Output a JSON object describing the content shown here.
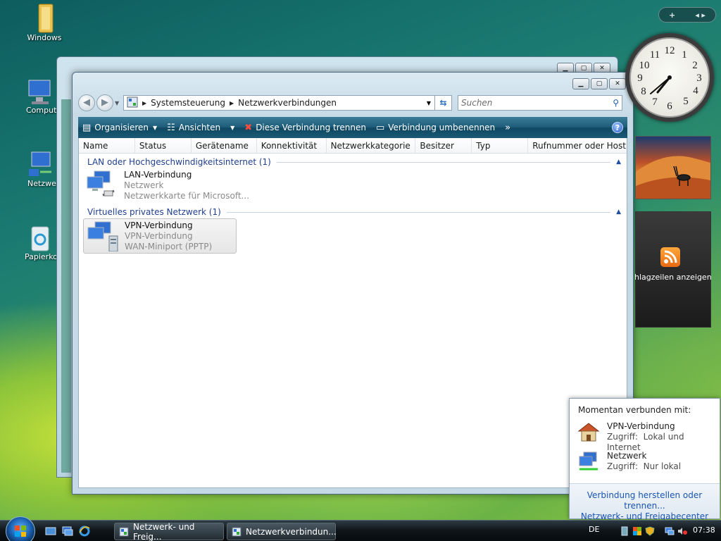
{
  "desktop": {
    "icons": [
      {
        "label": "Windows"
      },
      {
        "label": "Comput"
      },
      {
        "label": "Netzwe"
      },
      {
        "label": "Papierko"
      }
    ]
  },
  "window": {
    "breadcrumb": [
      "Systemsteuerung",
      "Netzwerkverbindungen"
    ],
    "search_placeholder": "Suchen",
    "toolbar": {
      "organize": "Organisieren",
      "views": "Ansichten",
      "disconnect": "Diese Verbindung trennen",
      "rename": "Verbindung umbenennen",
      "more": "»",
      "help": "?"
    },
    "columns": [
      "Name",
      "Status",
      "Gerätename",
      "Konnektivität",
      "Netzwerkkategorie",
      "Besitzer",
      "Typ",
      "Rufnummer oder Host..."
    ],
    "groups": [
      {
        "title": "LAN oder Hochgeschwindigkeitsinternet (1)",
        "items": [
          {
            "name": "LAN-Verbindung",
            "status": "Netzwerk",
            "device": "Netzwerkkarte für Microsoft..."
          }
        ]
      },
      {
        "title": "Virtuelles privates Netzwerk (1)",
        "items": [
          {
            "name": "VPN-Verbindung",
            "status": "VPN-Verbindung",
            "device": "WAN-Miniport (PPTP)"
          }
        ]
      }
    ]
  },
  "gadgets": {
    "sidebar_add": "+",
    "sidebar_nav": "◂ ▸",
    "feed_label": "hlagzeilen anzeigen",
    "clock_numbers": [
      "12",
      "1",
      "2",
      "3",
      "4",
      "5",
      "6",
      "7",
      "8",
      "9",
      "10",
      "11"
    ]
  },
  "popup": {
    "title": "Momentan verbunden mit:",
    "connections": [
      {
        "name": "VPN-Verbindung",
        "access_label": "Zugriff:",
        "access": "Lokal und Internet"
      },
      {
        "name": "Netzwerk",
        "access_label": "Zugriff:",
        "access": "Nur lokal"
      }
    ],
    "links": [
      "Verbindung herstellen oder trennen...",
      "Netzwerk- und Freigabecenter"
    ]
  },
  "taskbar": {
    "buttons": [
      "Netzwerk- und Freig...",
      "Netzwerkverbindun..."
    ],
    "language": "DE",
    "time": "07:38"
  }
}
